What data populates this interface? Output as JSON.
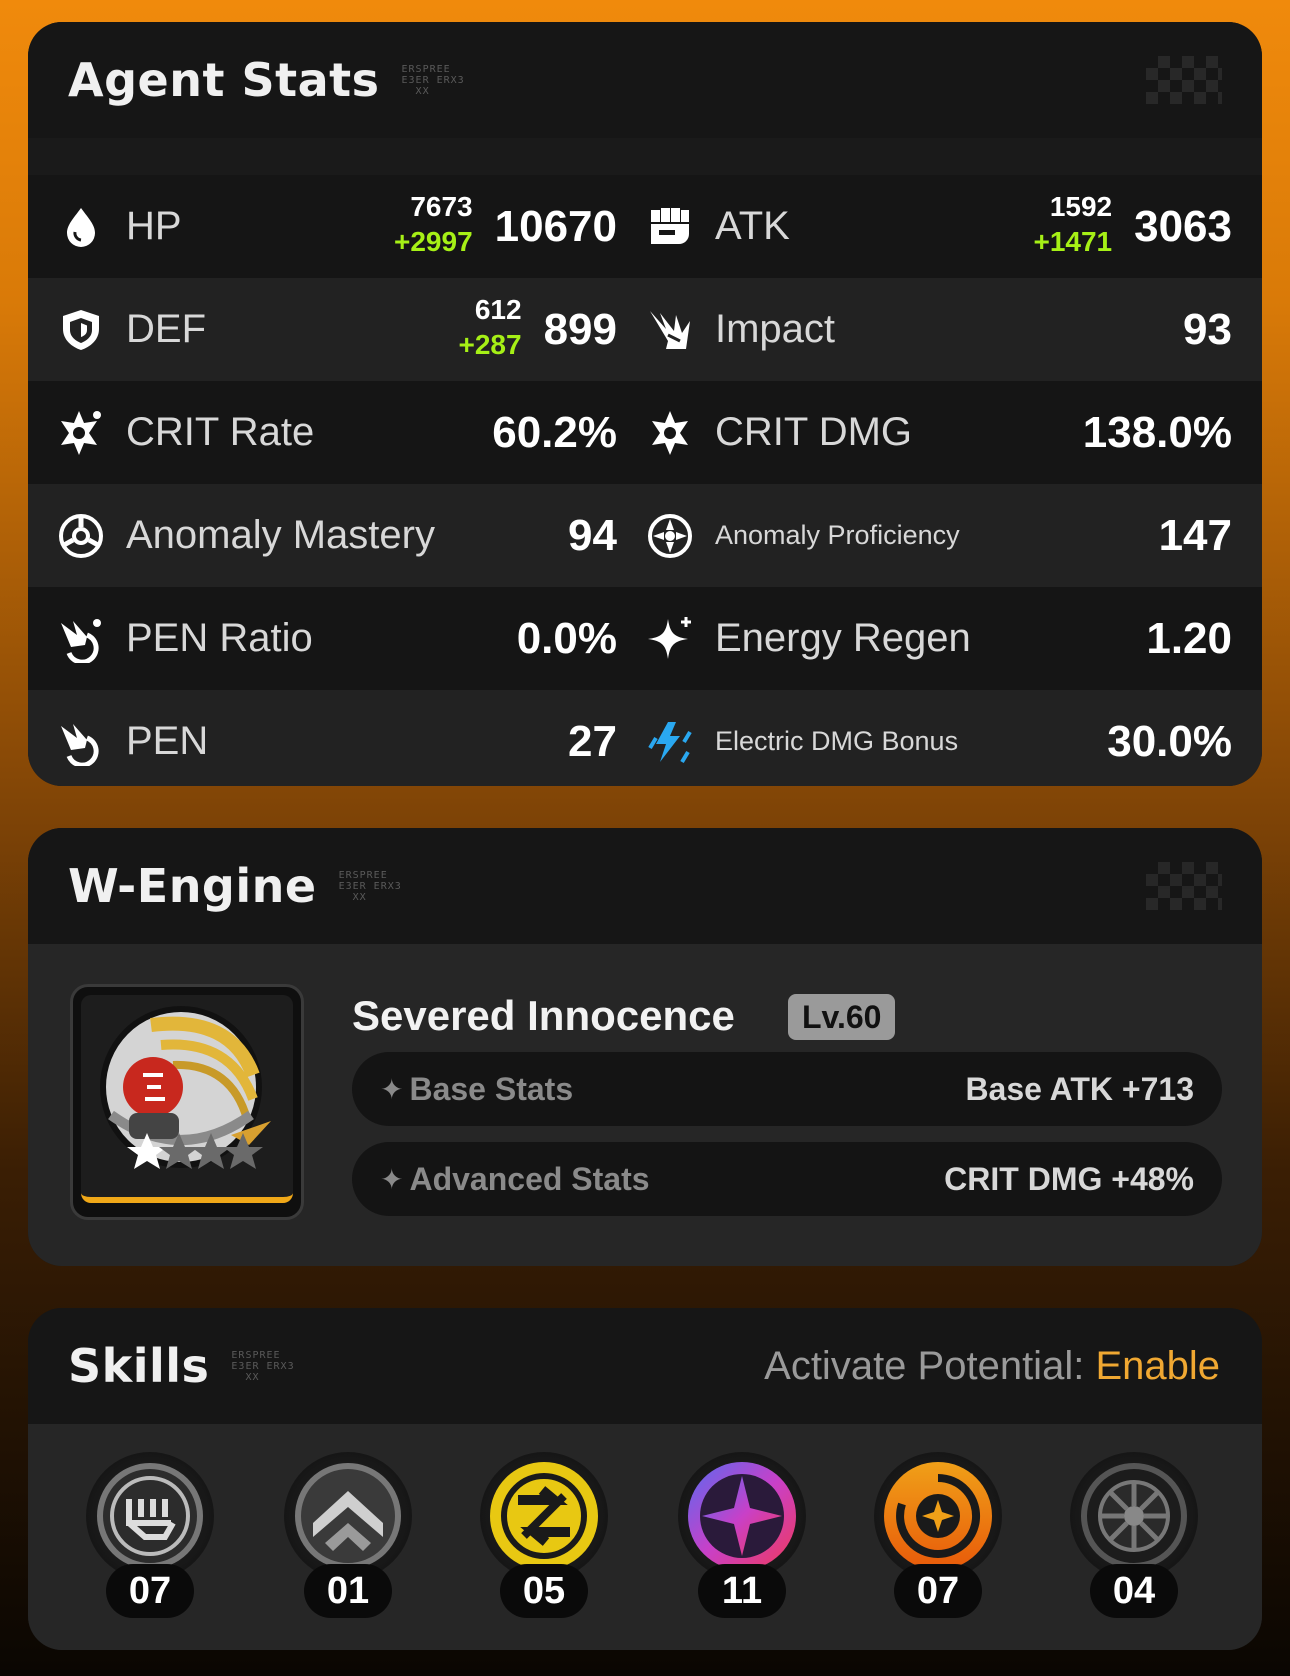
{
  "agent_stats": {
    "title": "Agent Stats",
    "deco": "ERSPREE\nE3ER ERX3\n  XX",
    "rows": [
      {
        "left": {
          "label": "HP",
          "icon": "drop-icon",
          "base": "7673",
          "bonus": "+2997",
          "value": "10670"
        },
        "right": {
          "label": "ATK",
          "icon": "fist-icon",
          "base": "1592",
          "bonus": "+1471",
          "value": "3063"
        }
      },
      {
        "left": {
          "label": "DEF",
          "icon": "shield-icon",
          "base": "612",
          "bonus": "+287",
          "value": "899"
        },
        "right": {
          "label": "Impact",
          "icon": "impact-icon",
          "value": "93"
        }
      },
      {
        "left": {
          "label": "CRIT Rate",
          "icon": "crit-rate-icon",
          "value": "60.2%"
        },
        "right": {
          "label": "CRIT DMG",
          "icon": "crit-dmg-icon",
          "value": "138.0%"
        }
      },
      {
        "left": {
          "label": "Anomaly Mastery",
          "icon": "anomaly-mastery-icon",
          "value": "94"
        },
        "right": {
          "label": "Anomaly Proficiency",
          "icon": "anomaly-proficiency-icon",
          "value": "147"
        }
      },
      {
        "left": {
          "label": "PEN Ratio",
          "icon": "pen-ratio-icon",
          "value": "0.0%"
        },
        "right": {
          "label": "Energy Regen",
          "icon": "energy-regen-icon",
          "value": "1.20"
        }
      },
      {
        "left": {
          "label": "PEN",
          "icon": "pen-icon",
          "value": "27"
        },
        "right": {
          "label": "Electric DMG Bonus",
          "icon": "electric-icon",
          "value": "30.0%"
        }
      }
    ]
  },
  "w_engine": {
    "title": "W-Engine",
    "deco": "ERSPREE\nE3ER ERX3\n  XX",
    "name": "Severed Innocence",
    "level": "Lv.60",
    "stars": 1,
    "max_stars": 5,
    "base_stats_label": "Base Stats",
    "base_stats_value": "Base ATK +713",
    "advanced_stats_label": "Advanced Stats",
    "advanced_stats_value": "CRIT DMG +48%"
  },
  "skills": {
    "title": "Skills",
    "deco": "ERSPREE\nE3ER ERX3\n  XX",
    "potential_label": "Activate Potential: ",
    "potential_value": "Enable",
    "items": [
      {
        "name": "basic-attack-icon",
        "level": "07"
      },
      {
        "name": "dodge-icon",
        "level": "01"
      },
      {
        "name": "assist-icon",
        "level": "05"
      },
      {
        "name": "special-attack-icon",
        "level": "11"
      },
      {
        "name": "chain-attack-icon",
        "level": "07"
      },
      {
        "name": "core-skill-icon",
        "level": "04"
      }
    ]
  },
  "colors": {
    "bonus_green": "#a6f016",
    "accent_orange": "#f0a832",
    "electric_blue": "#2aa8f0"
  }
}
